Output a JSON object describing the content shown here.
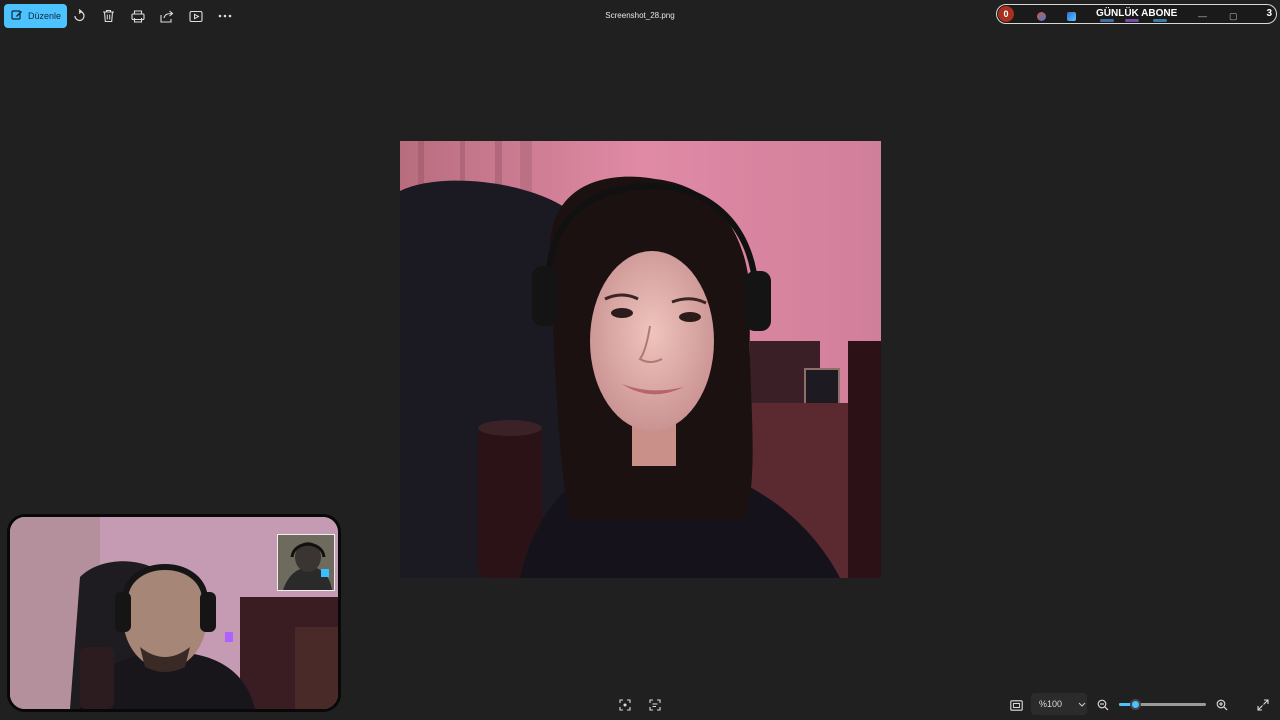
{
  "app": {
    "title": "Screenshot_28.png"
  },
  "toolbar": {
    "edit_label": "Düzenle",
    "icons": [
      "edit-icon",
      "rotate-icon",
      "delete-icon",
      "print-icon",
      "share-icon",
      "slideshow-icon",
      "more-icon"
    ]
  },
  "overlay": {
    "badge": "0",
    "label": "GÜNLÜK ABONE",
    "count": "3"
  },
  "viewer": {
    "zoom_label": "%100",
    "zoom_level": 100,
    "slider_fraction": 0.18,
    "accent": "#4cc2ff",
    "background": "#202020"
  },
  "bottom_icons": [
    "fit-to-window-icon",
    "select-text-icon",
    "actual-size-icon",
    "chevron-down-icon",
    "zoom-out-icon",
    "zoom-in-icon",
    "fullscreen-icon"
  ]
}
